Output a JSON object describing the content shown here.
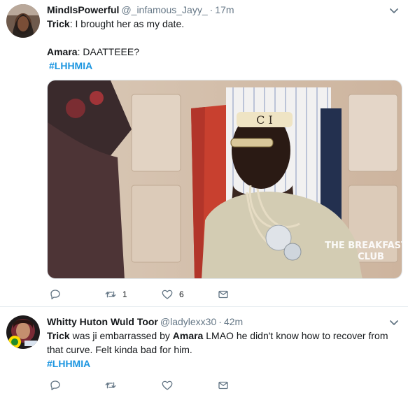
{
  "tweets": [
    {
      "name": "MindIsPowerful",
      "handle": "@_infamous_Jayy_",
      "dot": "·",
      "time": "17m",
      "lines": [
        {
          "speaker": "Trick",
          "text": ": I brought her as my date."
        },
        {
          "speaker": "Amara",
          "text": ": DAATTEEE?"
        }
      ],
      "hashtag": "#LHHMIA",
      "media": {
        "headband_text": "C I",
        "watermark_line1": "THE BREAKFAST",
        "watermark_line2": "CLUB"
      },
      "actions": {
        "reply_icon": "reply-icon",
        "retweet_icon": "retweet-icon",
        "retweet_count": "1",
        "like_icon": "heart-icon",
        "like_count": "6",
        "message_icon": "envelope-icon"
      }
    },
    {
      "name": "Whitty Huton Wuld Toor",
      "handle": "@ladylexx30",
      "dot": "·",
      "time": "42m",
      "line1_speaker1": "Trick",
      "line1_mid": " was ji embarrassed by ",
      "line1_speaker2": "Amara",
      "line1_rest": " LMAO he didn't know how to recover from",
      "line2": "that curve. Felt kinda bad for him.",
      "hashtag": "#LHHMIA",
      "actions": {
        "reply_icon": "reply-icon",
        "retweet_icon": "retweet-icon",
        "like_icon": "heart-icon",
        "message_icon": "envelope-icon"
      }
    }
  ],
  "colors": {
    "text": "#14171a",
    "muted": "#657786",
    "link": "#1b95e0",
    "border": "#e6ecf0"
  }
}
